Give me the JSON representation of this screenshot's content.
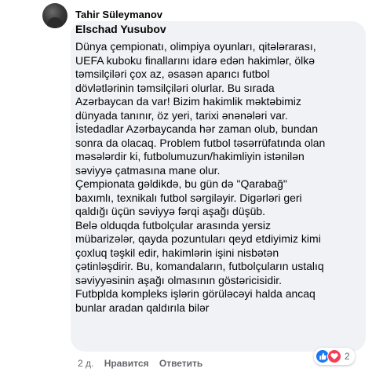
{
  "comment": {
    "author": "Tahir Süleymanov",
    "mention": "Elschad Yusubov",
    "lines": [
      "Dünya çempionatı, olimpiya oyunları, qitələrarası,",
      "UEFA kuboku finallarını idarə edən hakimlər, ölkə",
      "təmsilçiləri çox az, əsasən aparıcı futbol",
      "dövlətlərinin təmsilçiləri olurlar. Bu sırada",
      "Azərbaycan da var! Bizim hakimlik məktəbimiz",
      "dünyada tanınır, öz yeri, tarixi ənənələri var.",
      "İstedadlar Azərbaycanda hər zaman olub, bundan",
      "sonra da olacaq. Problem futbol təsərrüfatında olan",
      "məsələrdir ki, futbolumuzun/hakimliyin istənilən",
      "səviyyə çatmasına mane olur.",
      "Çempionata gəldikdə, bu gün də \"Qarabağ\"",
      "baxımlı, texnikalı futbol sərgiləyir. Digərləri geri",
      "qaldığı üçün səviyyə fərqi aşağı düşüb.",
      "Belə olduqda futbolçular arasında yersiz",
      "mübarizələr, qayda pozuntuları qeyd etdiyimiz kimi",
      "çoxluq təşkil edir, hakimlərin işini nisbətən",
      "çətinləşdirir. Bu, komandaların, futbolçuların ustalıq",
      "səviyyəsinin aşağı olmasının göstəricisidir.",
      "Futbplda kompleks işlərin görüləcəyi halda ancaq",
      "bunlar aradan qaldırıla bilər"
    ],
    "reaction_count": "2"
  },
  "footer": {
    "time": "2 д.",
    "like_label": "Нравится",
    "reply_label": "Ответить"
  },
  "icons": {
    "like": "thumbs-up-icon",
    "love": "heart-icon"
  },
  "colors": {
    "bubble": "#f0f2f5",
    "like": "#1877f2",
    "love": "#f33e58",
    "meta": "#65676b"
  }
}
